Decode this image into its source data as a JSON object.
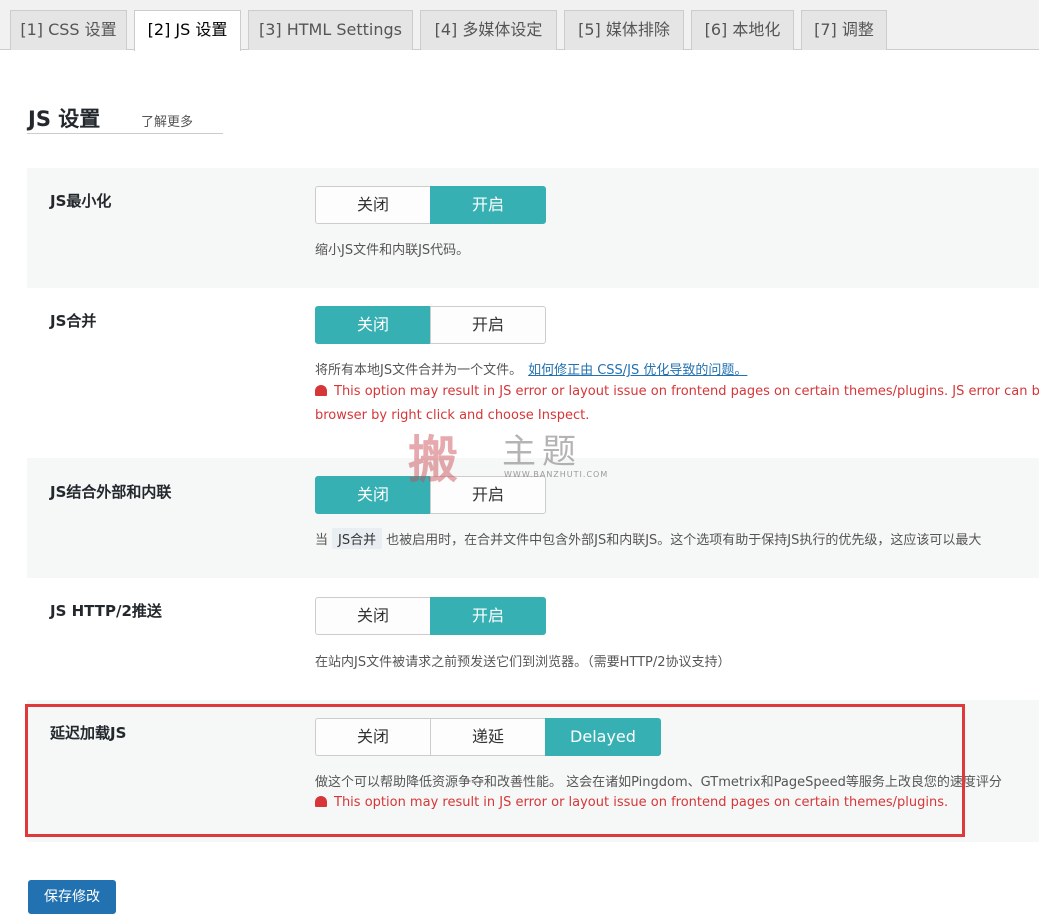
{
  "tabs": [
    {
      "label": "[1] CSS 设置",
      "active": false
    },
    {
      "label": "[2] JS 设置",
      "active": true
    },
    {
      "label": "[3] HTML Settings",
      "active": false
    },
    {
      "label": "[4] 多媒体设定",
      "active": false
    },
    {
      "label": "[5] 媒体排除",
      "active": false
    },
    {
      "label": "[6] 本地化",
      "active": false
    },
    {
      "label": "[7] 调整",
      "active": false
    }
  ],
  "section": {
    "title": "JS 设置",
    "learn_more": "了解更多"
  },
  "settings": [
    {
      "label": "JS最小化",
      "options": [
        "关闭",
        "开启"
      ],
      "selected": 1,
      "description": "缩小JS文件和内联JS代码。"
    },
    {
      "label": "JS合并",
      "options": [
        "关闭",
        "开启"
      ],
      "selected": 0,
      "description": "将所有本地JS文件合并为一个文件。",
      "link": "如何修正由 CSS/JS 优化导致的问题。",
      "warning_line1": "This option may result in JS error or layout issue on frontend pages on certain themes/plugins. JS error can be f",
      "warning_line2": "browser by right click and choose Inspect."
    },
    {
      "label": "JS结合外部和内联",
      "options": [
        "关闭",
        "开启"
      ],
      "selected": 0,
      "description_prefix": "当",
      "description_code": "JS合并",
      "description_suffix": "也被启用时，在合并文件中包含外部JS和内联JS。这个选项有助于保持JS执行的优先级，这应该可以最大"
    },
    {
      "label": "JS HTTP/2推送",
      "options": [
        "关闭",
        "开启"
      ],
      "selected": 1,
      "description": "在站内JS文件被请求之前预发送它们到浏览器。（需要HTTP/2协议支持）"
    },
    {
      "label": "延迟加载JS",
      "options": [
        "关闭",
        "递延",
        "Delayed"
      ],
      "selected": 2,
      "description": "做这个可以帮助降低资源争夺和改善性能。 这会在诸如Pingdom、GTmetrix和PageSpeed等服务上改良您的速度评分",
      "warning_line1": "This option may result in JS error or layout issue on frontend pages on certain themes/plugins."
    }
  ],
  "watermark": {
    "char": "搬",
    "text": "主题",
    "url": "WWW.BANZHUTI.COM"
  },
  "save_label": "保存修改",
  "colors": {
    "accent": "#36b0b3",
    "warning": "#d63638",
    "link": "#2271b1",
    "highlight": "#e0393c"
  }
}
